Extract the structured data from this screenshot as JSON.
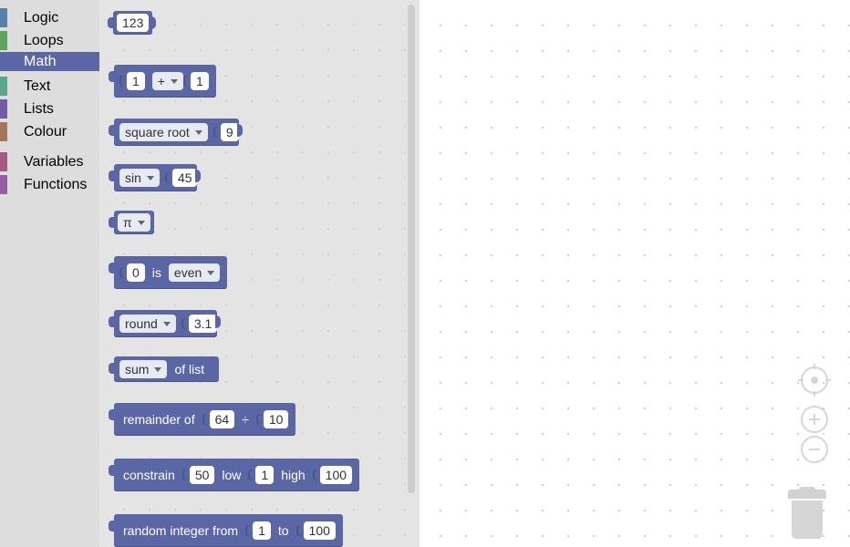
{
  "toolbox": {
    "categories": [
      {
        "label": "Logic",
        "color": "#5b80a5"
      },
      {
        "label": "Loops",
        "color": "#5ba55b"
      },
      {
        "label": "Math",
        "color": "#5b67a5",
        "selected": true
      },
      {
        "label": "Text",
        "color": "#5ba58c"
      },
      {
        "label": "Lists",
        "color": "#745ba5"
      },
      {
        "label": "Colour",
        "color": "#a5745b"
      },
      {
        "label": "Variables",
        "color": "#a55b80"
      },
      {
        "label": "Functions",
        "color": "#995ba5"
      }
    ],
    "selected_color": "#5b67a5"
  },
  "flyout": {
    "number": {
      "value": "123"
    },
    "arithmetic": {
      "a": "1",
      "op": "+",
      "b": "1"
    },
    "single": {
      "op": "square root",
      "value": "9"
    },
    "trig": {
      "op": "sin",
      "value": "45"
    },
    "constant": {
      "value": "π"
    },
    "property": {
      "value": "0",
      "is": "is",
      "prop": "even"
    },
    "round": {
      "op": "round",
      "value": "3.1"
    },
    "on_list": {
      "op": "sum",
      "suffix": "of list"
    },
    "modulo": {
      "label": "remainder of",
      "dividend": "64",
      "div": "÷",
      "divisor": "10"
    },
    "constrain": {
      "label": "constrain",
      "value": "50",
      "low_label": "low",
      "low": "1",
      "high_label": "high",
      "high": "100"
    },
    "random_int": {
      "label": "random integer from",
      "from": "1",
      "to_label": "to",
      "to": "100"
    }
  },
  "workspace": {
    "controls": [
      "recenter-icon",
      "zoom-in-icon",
      "zoom-out-icon",
      "trash-icon"
    ]
  }
}
